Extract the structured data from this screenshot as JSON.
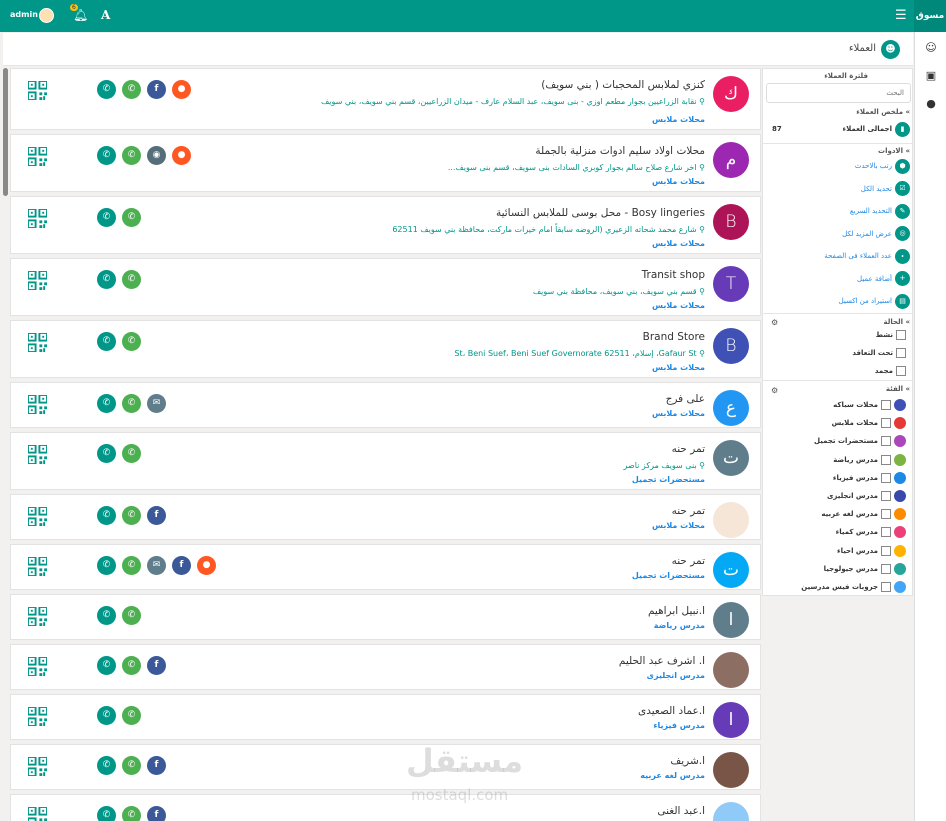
{
  "topbar": {
    "brand": "مسوق",
    "user_name": "admin",
    "notifications_count": "6"
  },
  "page": {
    "title": "العملاء"
  },
  "customers": [
    {
      "initial": "ك",
      "color": "#e91e63",
      "name": "كنزي لملابس المحجبات ( بني سويف)",
      "address": "نقابة الزراعيين بجوار مطعم اوزي - بنى سويف، عبد السلام عارف - ميدان الزراعيين، قسم بني سويف، بني سويف",
      "category": "محلات ملابس"
    },
    {
      "initial": "م",
      "color": "#9c27b0",
      "name": "محلات اولاد سليم ادوات منزلية بالجملة",
      "address": "اخر شارع صلاح سالم بجوار كوبري السادات بنى سويف، قسم بنى سويف...",
      "category": "محلات ملابس"
    },
    {
      "initial": "B",
      "color": "#ad1457",
      "name": "Bosy lingeries - محل بوسى للملابس النسائية",
      "address": "شارع محمد شحاته الزعيري (الروضه سابقاً امام خيرات ماركت، محافظة بني سويف 62511",
      "category": "محلات ملابس"
    },
    {
      "initial": "T",
      "color": "#673ab7",
      "name": "Transit shop",
      "address": "قسم بني سويف، بني سويف، محافظة بني سويف",
      "category": "محلات ملابس"
    },
    {
      "initial": "B",
      "color": "#3f51b5",
      "name": "Brand Store",
      "address": "Gafaur St، إسلام، St، Beni Suef، Beni Suef Governorate 62511",
      "category": "محلات ملابس"
    },
    {
      "initial": "ع",
      "color": "#2196f3",
      "name": "على فرج",
      "address": "",
      "category": "محلات ملابس"
    },
    {
      "initial": "ت",
      "color": "#607d8b",
      "name": "تمر حنه",
      "address": "بنى سويف مركز ناصر",
      "category": "مستحضرات تجميل"
    },
    {
      "initial": "",
      "color": "#f5e6d8",
      "name": "تمر حنه",
      "address": "",
      "category": "محلات ملابس"
    },
    {
      "initial": "ت",
      "color": "#03a9f4",
      "name": "تمر حنه",
      "address": "",
      "category": "مستحضرات تجميل"
    },
    {
      "initial": "ا",
      "color": "#607d8b",
      "name": "ا.نبيل ابراهيم",
      "address": "",
      "category": "مدرس رياضة"
    },
    {
      "initial": "",
      "color": "#8d6e63",
      "name": "ا. اشرف عبد الحليم",
      "address": "",
      "category": "مدرس انجليزى"
    },
    {
      "initial": "ا",
      "color": "#673ab7",
      "name": "ا.عماد الصعيدى",
      "address": "",
      "category": "مدرس فيزياء"
    },
    {
      "initial": "",
      "color": "#795548",
      "name": "ا.شريف",
      "address": "",
      "category": "مدرس لغه عربيه"
    },
    {
      "initial": "",
      "color": "#90caf9",
      "name": "ا.عبد الغنى",
      "address": "",
      "category": ""
    }
  ],
  "sidebar": {
    "filter_title": "فلترة العملاء",
    "search_placeholder": "البحث",
    "summary_title": "ملخص العملاء",
    "total_label": "اجمالى العملاء",
    "total_count": "87",
    "tools_title": "الادوات",
    "tools": [
      "رتب بالاحدث",
      "تحديد الكل",
      "التحديد السريع",
      "عرض المزيد لكل",
      "عدد العملاء فى الصفحة",
      "أضافة عميل",
      "استيراد من اكسيل"
    ],
    "status_title": "الحالة",
    "statuses": [
      "نشط",
      "تحت التعاقد",
      "مجمد"
    ],
    "category_title": "الفئة",
    "categories": [
      "محلات سباكه",
      "محلات ملابس",
      "مستحضرات تجميل",
      "مدرس رياضة",
      "مدرس فيزياء",
      "مدرس انجليزى",
      "مدرس لغه عربيه",
      "مدرس كمياء",
      "مدرس احياء",
      "مدرس جيولوجيا",
      "جروبات فيس مدرسين"
    ]
  },
  "watermark": {
    "arabic": "مستقل",
    "latin": "mostaql.com"
  },
  "colors": {
    "primary": "#009688",
    "link": "#1e88e5"
  }
}
